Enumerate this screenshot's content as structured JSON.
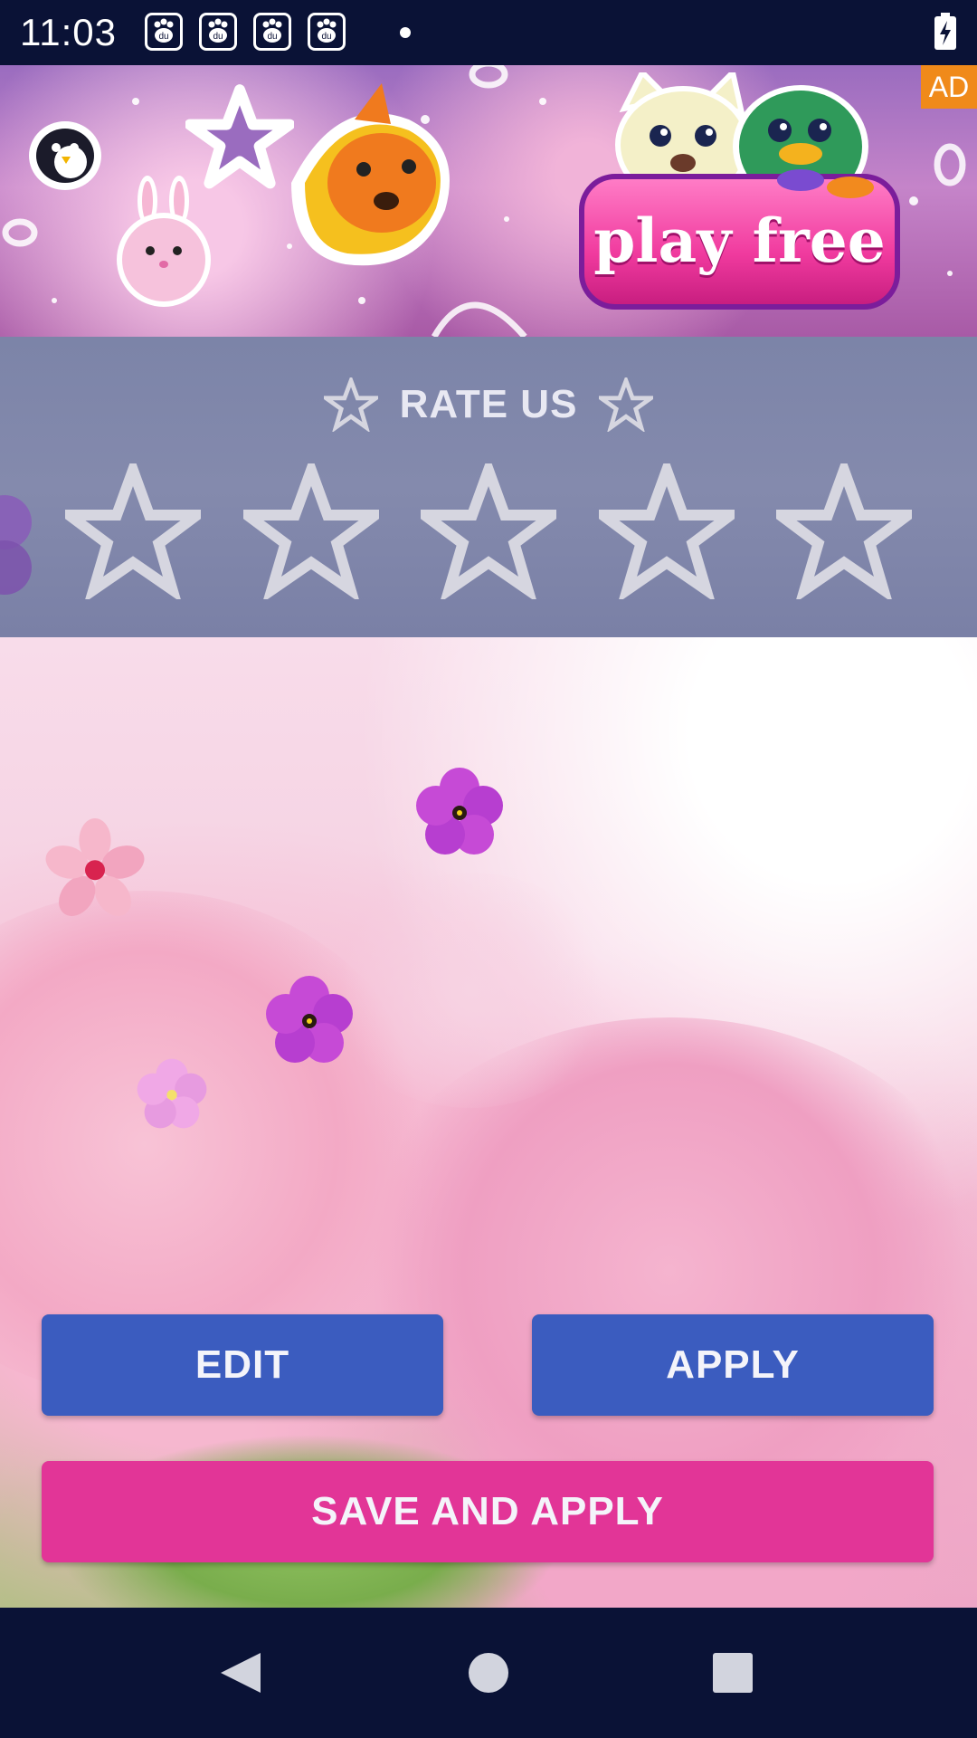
{
  "status_bar": {
    "time": "11:03",
    "notification_icons": [
      "baidu-paw-icon",
      "baidu-paw-icon",
      "baidu-paw-icon",
      "baidu-paw-icon"
    ],
    "notification_icon_text": "du",
    "battery_icon": "battery-charging-icon"
  },
  "ad": {
    "badge": "AD",
    "cta_label": "play free"
  },
  "rate": {
    "title": "RATE US",
    "star_count": 5,
    "selected_rating": 0
  },
  "actions": {
    "edit_label": "EDIT",
    "apply_label": "APPLY",
    "save_apply_label": "SAVE AND APPLY"
  },
  "nav_bar": {
    "back_icon": "back-triangle-icon",
    "home_icon": "home-circle-icon",
    "recents_icon": "recents-square-icon"
  },
  "colors": {
    "system_bar": "#0a1236",
    "ad_badge": "#f08a1a",
    "rate_panel": "#7c84a8",
    "primary_button": "#3b5cbf",
    "accent_button": "#e23597",
    "star_outline": "#d6d6e0"
  }
}
